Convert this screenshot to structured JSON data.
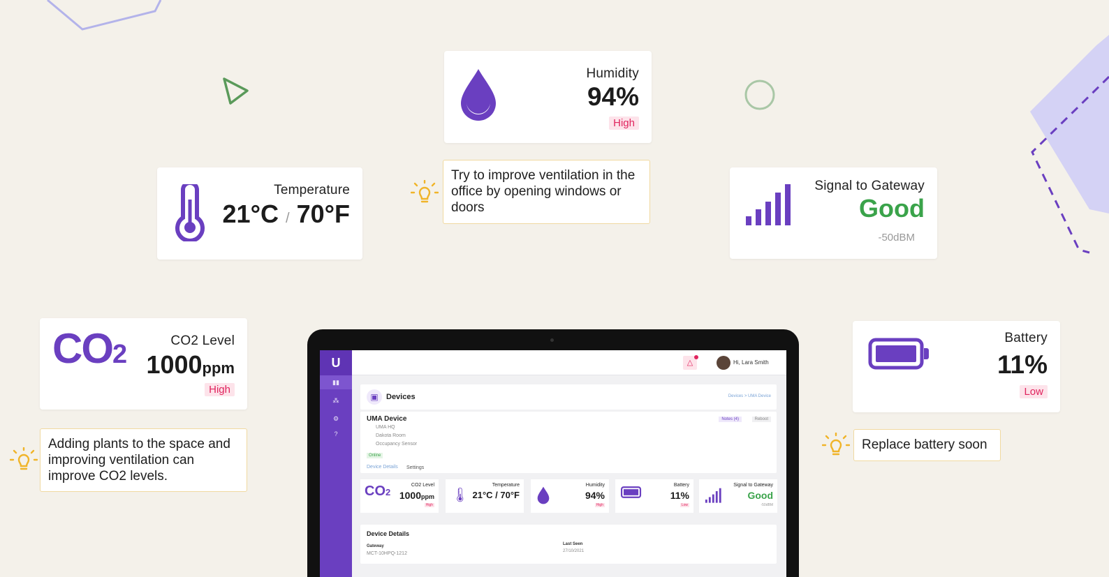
{
  "colors": {
    "accent": "#6a3fc0",
    "good": "#3aa34a",
    "high_badge_bg": "#fde3ea",
    "high_badge_text": "#e0245e",
    "tip_border": "#f0d9a0",
    "bulb": "#f0b429"
  },
  "humidity": {
    "label": "Humidity",
    "value": "94%",
    "status": "High",
    "icon": "droplet-icon"
  },
  "temperature": {
    "label": "Temperature",
    "celsius": "21",
    "fahrenheit": "70",
    "unit_c": "°C",
    "unit_f": "°F",
    "sep": "/",
    "icon": "thermometer-icon"
  },
  "signal": {
    "label": "Signal to Gateway",
    "value": "Good",
    "dbm": "-50dBM",
    "icon": "signal-bars-icon"
  },
  "co2": {
    "label": "CO2 Level",
    "value": "1000",
    "unit": "ppm",
    "status": "High",
    "icon_text": "CO",
    "icon_sub": "2"
  },
  "battery": {
    "label": "Battery",
    "value": "11%",
    "status": "Low",
    "icon": "battery-icon"
  },
  "tips": {
    "ventilation": "Try to improve ventilation in the office by opening windows or doors",
    "plants": "Adding plants to the space and improving ventilation can improve CO2 levels.",
    "battery": "Replace battery soon"
  },
  "app": {
    "logo": "U",
    "user_greeting": "Hi, Lara Smith",
    "page_title": "Devices",
    "breadcrumb": "Devices > UMA Device",
    "device_name": "UMA Device",
    "location": "UMA HQ",
    "room": "Dakota Room",
    "sensor_type": "Occupancy Sensor",
    "status": "Online",
    "notes_button": "Notes (4)",
    "reboot_button": "Reboot",
    "tabs": [
      "Device Details",
      "Settings"
    ],
    "details_title": "Device Details",
    "gateway_label": "Gateway",
    "gateway_value": "MCT-10HPQ-1212",
    "last_seen_label": "Last Seen",
    "last_seen_value": "27/10/2021",
    "mini": {
      "co2_label": "CO2 Level",
      "co2_value": "1000",
      "co2_unit": "ppm",
      "co2_status": "High",
      "temp_label": "Temperature",
      "temp_value": "21°C / 70°F",
      "hum_label": "Humidity",
      "hum_value": "94%",
      "hum_status": "High",
      "bat_label": "Battery",
      "bat_value": "11%",
      "bat_status": "Low",
      "sig_label": "Signal to Gateway",
      "sig_value": "Good",
      "sig_dbm": "-50dBM"
    }
  }
}
